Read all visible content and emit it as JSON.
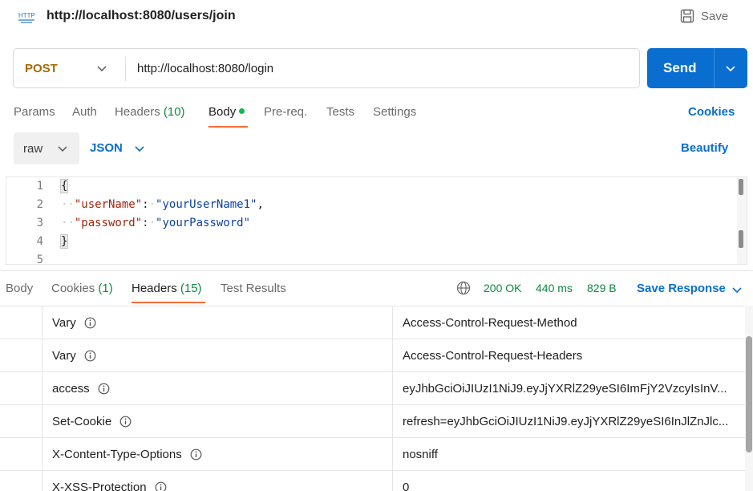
{
  "title_bar": {
    "url": "http://localhost:8080/users/join",
    "save_label": "Save",
    "http_icon": "http-icon",
    "save_icon": "floppy-disk-icon"
  },
  "request": {
    "method": "POST",
    "url": "http://localhost:8080/login",
    "send_label": "Send"
  },
  "request_tabs": [
    {
      "label": "Params"
    },
    {
      "label": "Auth"
    },
    {
      "label": "Headers",
      "count": "(10)"
    },
    {
      "label": "Body"
    },
    {
      "label": "Pre-req."
    },
    {
      "label": "Tests"
    },
    {
      "label": "Settings"
    }
  ],
  "cookies_link": "Cookies",
  "body_controls": {
    "mode": "raw",
    "format": "JSON",
    "beautify": "Beautify"
  },
  "editor": {
    "line_numbers": [
      "1",
      "2",
      "3",
      "4",
      "5"
    ],
    "open_brace": "{",
    "close_brace": "}",
    "line2_key": "\"userName\"",
    "line2_value": "\"yourUserName1\"",
    "line3_key": "\"password\"",
    "line3_value": "\"yourPassword\""
  },
  "response_tabs": [
    {
      "label": "Body"
    },
    {
      "label": "Cookies",
      "count": "(1)"
    },
    {
      "label": "Headers",
      "count": "(15)"
    },
    {
      "label": "Test Results"
    }
  ],
  "response_status": {
    "status": "200 OK",
    "time": "440 ms",
    "size": "829 B",
    "save_response": "Save Response"
  },
  "headers": [
    {
      "key": "Vary",
      "value": "Access-Control-Request-Method"
    },
    {
      "key": "Vary",
      "value": "Access-Control-Request-Headers"
    },
    {
      "key": "access",
      "value": "eyJhbGciOiJIUzI1NiJ9.eyJjYXRlZ29yeSI6ImFjY2VzcyIsInV..."
    },
    {
      "key": "Set-Cookie",
      "value": "refresh=eyJhbGciOiJIUzI1NiJ9.eyJjYXRlZ29yeSI6InJlZnJlc..."
    },
    {
      "key": "X-Content-Type-Options",
      "value": "nosniff"
    },
    {
      "key": "X-XSS-Protection",
      "value": "0"
    }
  ],
  "colors": {
    "accent": "#0a6ed1",
    "method": "#a56b00",
    "status_ok": "#0c8a3e",
    "tab_underline": "#ff6c37"
  }
}
